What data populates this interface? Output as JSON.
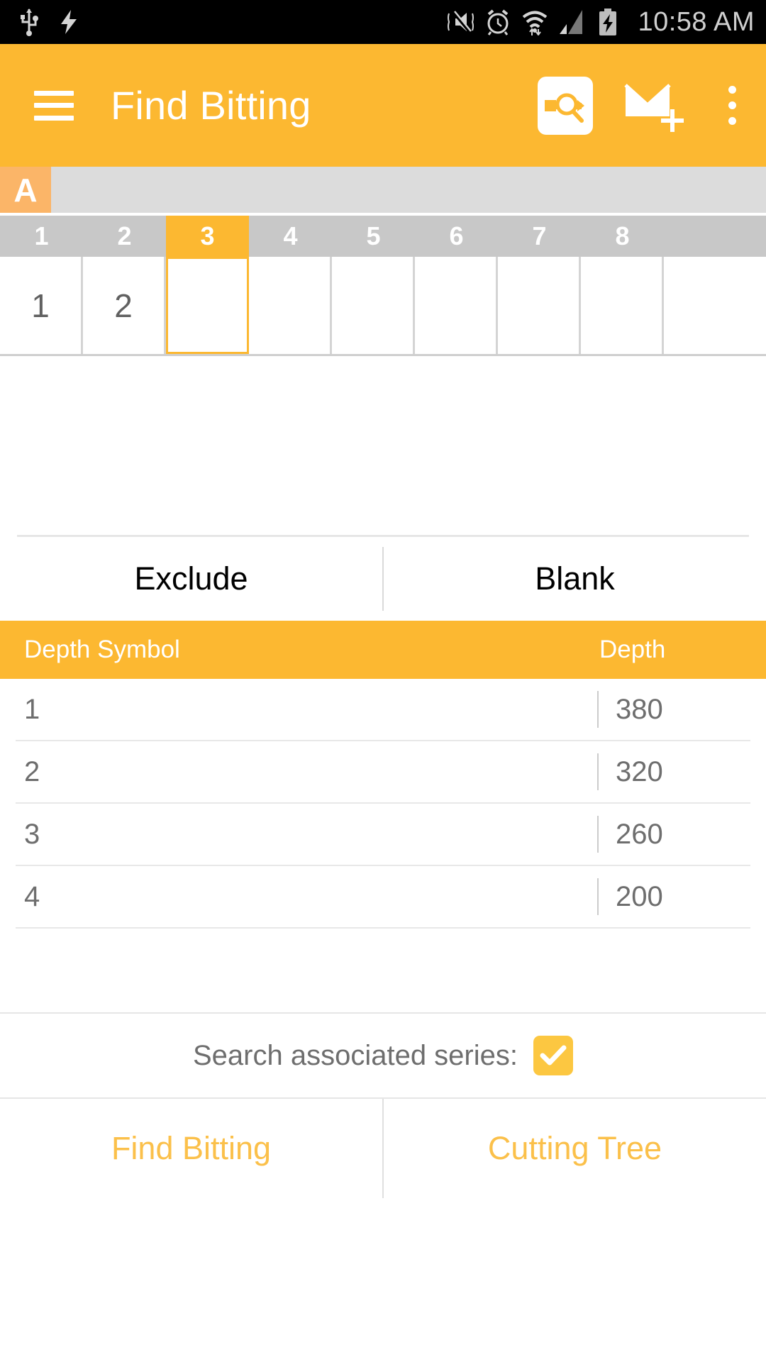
{
  "status_bar": {
    "time": "10:58 AM",
    "left_icons": [
      "usb-icon",
      "charging-bolt-icon"
    ],
    "right_icons": [
      "vibrate-mute-icon",
      "alarm-icon",
      "wifi-data-icon",
      "signal-icon",
      "battery-charging-icon"
    ]
  },
  "app_bar": {
    "menu_icon": "hamburger-menu-icon",
    "title": "Find Bitting",
    "actions": [
      {
        "name": "key-search-icon",
        "label": "Key Search"
      },
      {
        "name": "envelope-plus-icon",
        "label": "New Message"
      },
      {
        "name": "overflow-menu-icon",
        "label": "More options"
      }
    ]
  },
  "spreadsheet": {
    "row_label": "A",
    "column_headers": [
      "1",
      "2",
      "3",
      "4",
      "5",
      "6",
      "7",
      "8"
    ],
    "selected_column": "3",
    "cells": [
      "1",
      "2",
      "",
      "",
      "",
      "",
      "",
      ""
    ]
  },
  "actions": {
    "exclude_label": "Exclude",
    "blank_label": "Blank"
  },
  "depth_table": {
    "headers": {
      "symbol": "Depth Symbol",
      "depth": "Depth"
    },
    "rows": [
      {
        "symbol": "1",
        "depth": "380"
      },
      {
        "symbol": "2",
        "depth": "320"
      },
      {
        "symbol": "3",
        "depth": "260"
      },
      {
        "symbol": "4",
        "depth": "200"
      }
    ]
  },
  "options": {
    "search_series_label": "Search associated series:",
    "search_series_checked": true,
    "checkbox_icon": "checkmark-icon"
  },
  "bottom_bar": {
    "find_bitting_label": "Find Bitting",
    "cutting_tree_label": "Cutting Tree"
  },
  "colors": {
    "accent": "#fcb831",
    "accent_light": "#fbb568",
    "checkbox": "#fcc741",
    "bottom_text": "#fbc04a",
    "header_grey": "#c8c8c8",
    "toprow_grey": "#dcdcdc",
    "text_grey": "#6e6e6e"
  }
}
